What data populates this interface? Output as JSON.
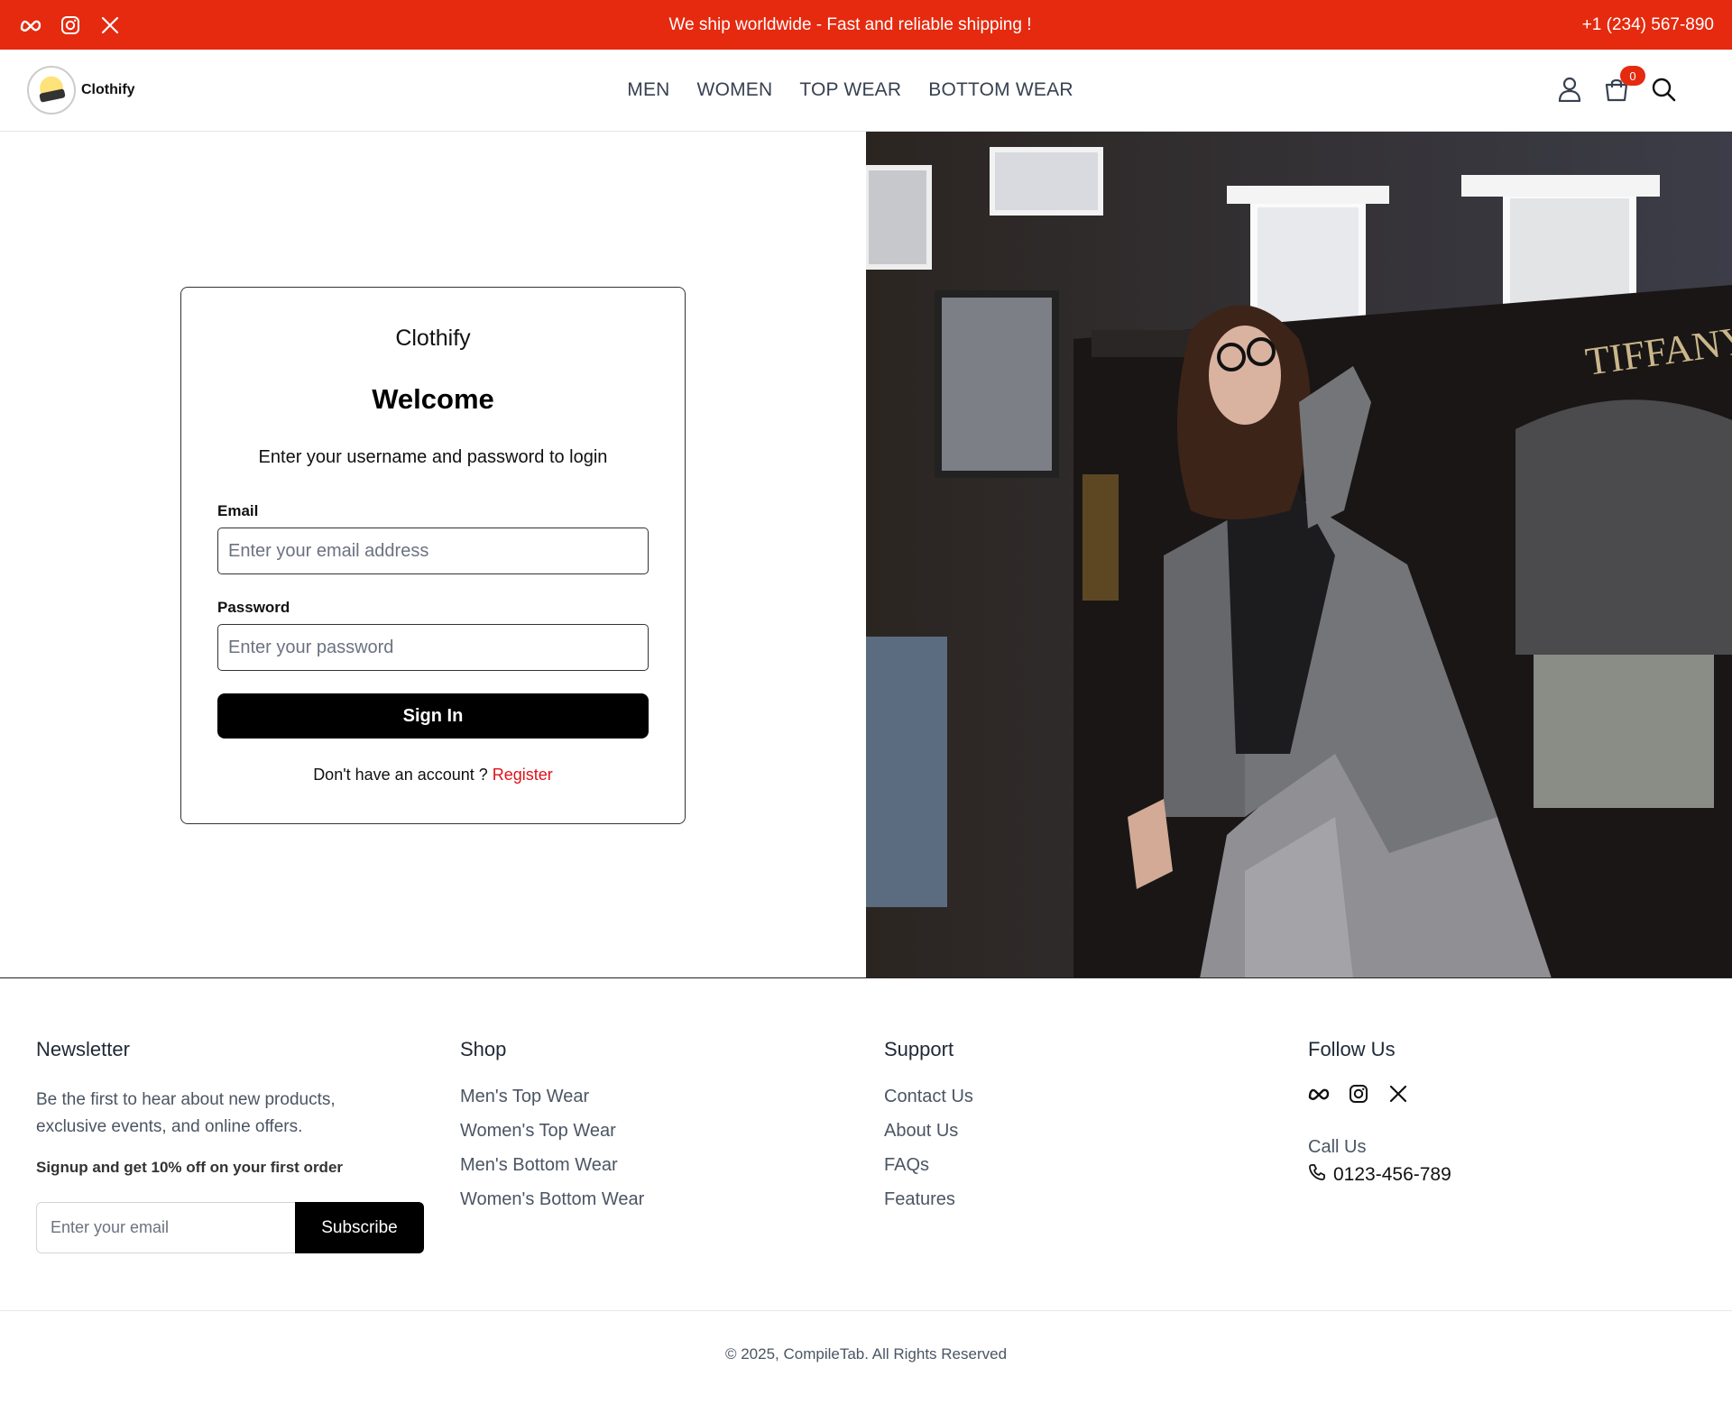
{
  "topbar": {
    "message": "We ship worldwide - Fast and reliable shipping !",
    "phone": "+1 (234) 567-890",
    "socials": [
      "meta-icon",
      "instagram-icon",
      "x-icon"
    ],
    "background": "#e52a0f"
  },
  "header": {
    "logo_text": "Clothify",
    "nav": [
      "MEN",
      "WOMEN",
      "TOP WEAR",
      "BOTTOM WEAR"
    ],
    "cart_count": "0",
    "icons": [
      "user-icon",
      "cart-icon",
      "search-icon"
    ]
  },
  "login": {
    "brand": "Clothify",
    "title": "Welcome",
    "subtitle": "Enter your username and password to login",
    "email_label": "Email",
    "email_placeholder": "Enter your email address",
    "password_label": "Password",
    "password_placeholder": "Enter your password",
    "signin_label": "Sign In",
    "no_account_text": "Don't have an account ? ",
    "register_link": "Register"
  },
  "footer": {
    "newsletter": {
      "title": "Newsletter",
      "text": "Be the first to hear about new products, exclusive events, and online offers.",
      "offer": "Signup and get 10% off on your first order",
      "placeholder": "Enter your email",
      "button": "Subscribe"
    },
    "shop": {
      "title": "Shop",
      "links": [
        "Men's Top Wear",
        "Women's Top Wear",
        "Men's Bottom Wear",
        "Women's Bottom Wear"
      ]
    },
    "support": {
      "title": "Support",
      "links": [
        "Contact Us",
        "About Us",
        "FAQs",
        "Features"
      ]
    },
    "follow": {
      "title": "Follow Us",
      "call_label": "Call Us",
      "phone": "0123-456-789"
    },
    "copyright": "© 2025, CompileTab. All Rights Reserved"
  }
}
